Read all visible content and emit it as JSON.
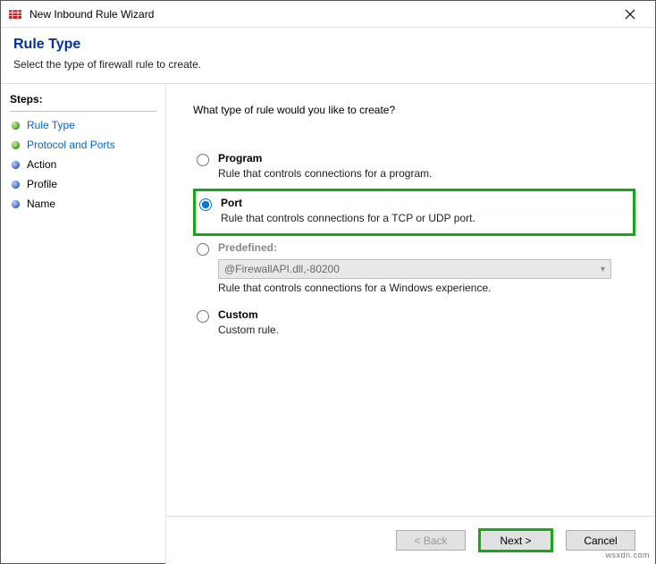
{
  "window": {
    "title": "New Inbound Rule Wizard"
  },
  "header": {
    "title": "Rule Type",
    "subtitle": "Select the type of firewall rule to create."
  },
  "sidebar": {
    "steps_label": "Steps:",
    "items": [
      {
        "label": "Rule Type",
        "bullet": "green",
        "link": true
      },
      {
        "label": "Protocol and Ports",
        "bullet": "green",
        "link": true
      },
      {
        "label": "Action",
        "bullet": "blue",
        "link": false
      },
      {
        "label": "Profile",
        "bullet": "blue",
        "link": false
      },
      {
        "label": "Name",
        "bullet": "blue",
        "link": false
      }
    ]
  },
  "main": {
    "prompt": "What type of rule would you like to create?",
    "options": {
      "program": {
        "label": "Program",
        "desc": "Rule that controls connections for a program.",
        "selected": false
      },
      "port": {
        "label": "Port",
        "desc": "Rule that controls connections for a TCP or UDP port.",
        "selected": true,
        "highlighted": true
      },
      "predefined": {
        "label": "Predefined:",
        "desc": "Rule that controls connections for a Windows experience.",
        "selected": false,
        "disabled": true,
        "dropdown_value": "@FirewallAPI.dll,-80200"
      },
      "custom": {
        "label": "Custom",
        "desc": "Custom rule.",
        "selected": false
      }
    }
  },
  "footer": {
    "back": "< Back",
    "next": "Next >",
    "cancel": "Cancel"
  },
  "watermark": "wsxdn.com"
}
